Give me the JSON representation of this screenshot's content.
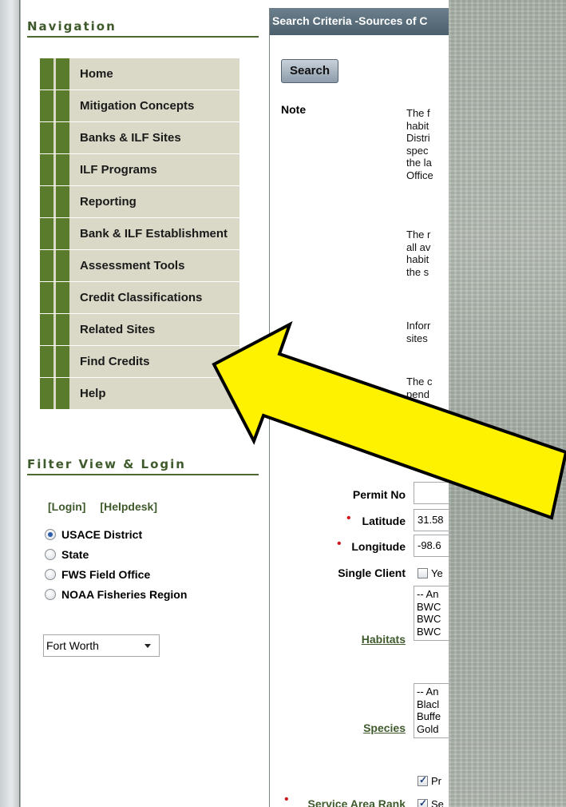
{
  "sidebar": {
    "nav_title": "Navigation",
    "nav_items": [
      {
        "label": "Home"
      },
      {
        "label": "Mitigation Concepts"
      },
      {
        "label": "Banks & ILF Sites"
      },
      {
        "label": "ILF Programs"
      },
      {
        "label": "Reporting"
      },
      {
        "label": "Bank & ILF Establishment"
      },
      {
        "label": "Assessment Tools"
      },
      {
        "label": "Credit Classifications"
      },
      {
        "label": "Related Sites"
      },
      {
        "label": "Find Credits"
      },
      {
        "label": "Help"
      }
    ],
    "filter_title": "Filter View & Login",
    "login_link": "[Login]",
    "helpdesk_link": "[Helpdesk]",
    "radio_options": [
      {
        "label": "USACE District",
        "checked": true
      },
      {
        "label": "State",
        "checked": false
      },
      {
        "label": "FWS Field Office",
        "checked": false
      },
      {
        "label": "NOAA Fisheries Region",
        "checked": false
      }
    ],
    "district_select": "Fort Worth"
  },
  "panel": {
    "header": "Search Criteria -Sources of C",
    "search_button": "Search",
    "note_label": "Note",
    "note_paragraphs": [
      "The f\nhabit\nDistri\nspec\nthe la\nOffice",
      "The r\nall av\nhabit\nthe s",
      "Inforr\nsites",
      "The c\npend"
    ],
    "fields": {
      "permit_no_label": "Permit No",
      "permit_no_value": "",
      "latitude_label": "Latitude",
      "latitude_value": "31.58",
      "longitude_label": "Longitude",
      "longitude_value": "-98.6",
      "single_client_label": "Single Client",
      "single_client_option": "Ye",
      "habitats_label": "Habitats",
      "habitats_options": [
        "-- An",
        "BWC",
        "BWC",
        "BWC"
      ],
      "species_label": "Species",
      "species_options": [
        "-- An",
        "Blacl",
        "Buffe",
        "Gold"
      ],
      "pr_option": "Pr",
      "service_area_label": "Service Area Rank",
      "service_area_option": "Se"
    }
  },
  "colors": {
    "nav_green": "#5a7a2c",
    "nav_bg": "#dad8c6",
    "title_green": "#3f5a2c",
    "header_bg": "#5a6d7b",
    "arrow_fill": "#fff200",
    "required": "#d0151c"
  }
}
